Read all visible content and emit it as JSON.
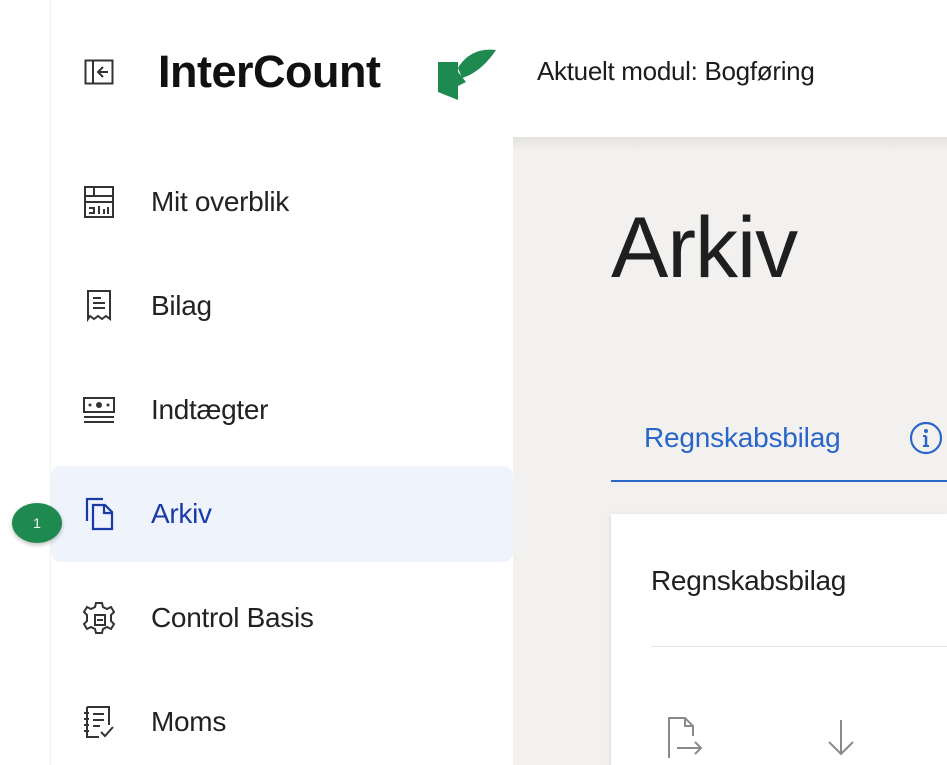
{
  "header": {
    "brand": "InterCount",
    "module_label": "Aktuelt modul: Bogføring",
    "brand_color": "#1e8a4f",
    "icons": {
      "collapse": "sidebar-collapse-icon",
      "logo": "intercount-leaf-logo"
    }
  },
  "sidebar": {
    "active_badge": "1",
    "items": [
      {
        "label": "Mit overblik",
        "icon": "dashboard-icon"
      },
      {
        "label": "Bilag",
        "icon": "receipt-icon"
      },
      {
        "label": "Indtægter",
        "icon": "income-icon"
      },
      {
        "label": "Arkiv",
        "icon": "archive-copy-icon",
        "active": true
      },
      {
        "label": "Control Basis",
        "icon": "settings-gear-icon"
      },
      {
        "label": "Moms",
        "icon": "vat-list-icon"
      }
    ]
  },
  "main": {
    "title": "Arkiv",
    "tab_label": "Regnskabsbilag",
    "card_title": "Regnskabsbilag",
    "accent_color": "#2a66c9",
    "active_bg": "#eef3fc"
  }
}
